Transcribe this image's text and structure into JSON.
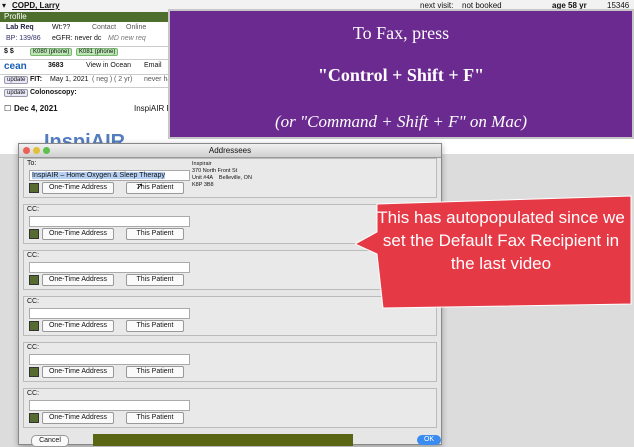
{
  "header": {
    "patient_name": "COPD, Larry",
    "next_visit_label": "next visit:",
    "next_visit_value": "not booked",
    "age": "age 58 yr",
    "id": "15346"
  },
  "profile_bar": "Profile",
  "summary": {
    "lab_req": "Lab Req",
    "wt": "Wt:??",
    "contact": "Contact",
    "online": "Online",
    "bp": "BP: 139/86",
    "egfr": "eGFR: never dc",
    "md_req": "MD new req",
    "dollar": "$ $",
    "k080": "K080 (phone)",
    "k081": "K081 (phone)",
    "ocean": "cean",
    "ocean_num": "3683",
    "view_in_ocean": "View in Ocean",
    "email": "Email",
    "update1": "update",
    "fit_label": "FIT:",
    "fit_date": "May 1, 2021",
    "fit_neg": "( neg )",
    "fit_yr": "( 2 yr)",
    "never_label": "never ha",
    "update2": "update",
    "colonoscopy": "Colonoscopy:"
  },
  "encounter": {
    "date": "Dec 4, 2021",
    "title": "InspiAIR Recipi"
  },
  "dialog": {
    "title": "Addressees",
    "to_label": "To:",
    "to_value": "InspiAIR – Home Oxygen & Sleep Therapy",
    "address": "Inspirair\n370 North Front St\nUnit #4A    Belleville, ON\nK8P 3B8",
    "cc_label": "CC:",
    "one_time": "One-Time Address",
    "this_patient": "This Patient",
    "cancel": "Cancel",
    "ok": "OK"
  },
  "banner": {
    "line1": "To Fax, press",
    "line2": "\"Control + Shift + F\"",
    "line3": "(or \"Command + Shift + F\" on Mac)"
  },
  "callout": {
    "text": "This has autopopulated since we set the Default Fax Recipient in the last video"
  },
  "colors": {
    "banner": "#6b2a8f",
    "callout": "#e63946",
    "profile": "#4e6e2e"
  }
}
